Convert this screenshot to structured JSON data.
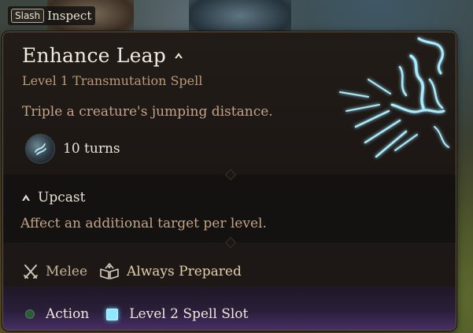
{
  "hint": {
    "key": "Slash",
    "action": "Inspect"
  },
  "spell": {
    "name": "Enhance Leap",
    "subtitle": "Level 1 Transmutation Spell",
    "description": "Triple a creature's jumping distance.",
    "duration": "10 turns",
    "upcast": {
      "label": "Upcast",
      "description": "Affect an additional target per level."
    },
    "tags": [
      {
        "label": "Melee",
        "icon": "crossed-swords-icon"
      },
      {
        "label": "Always Prepared",
        "icon": "spellbook-icon"
      }
    ],
    "costs": [
      {
        "label": "Action",
        "icon": "action-dot-icon",
        "color": "#2c5a3a"
      },
      {
        "label": "Level 2 Spell Slot",
        "icon": "spell-slot-icon",
        "color": "#8fe8ff"
      }
    ]
  },
  "colors": {
    "panel": "#1b1714",
    "title": "#f2ebdf",
    "subtitle": "#b89a78",
    "description": "#c4a487",
    "spell_glow": "#9fe6ff",
    "cost_band": "#4a2f6a"
  }
}
